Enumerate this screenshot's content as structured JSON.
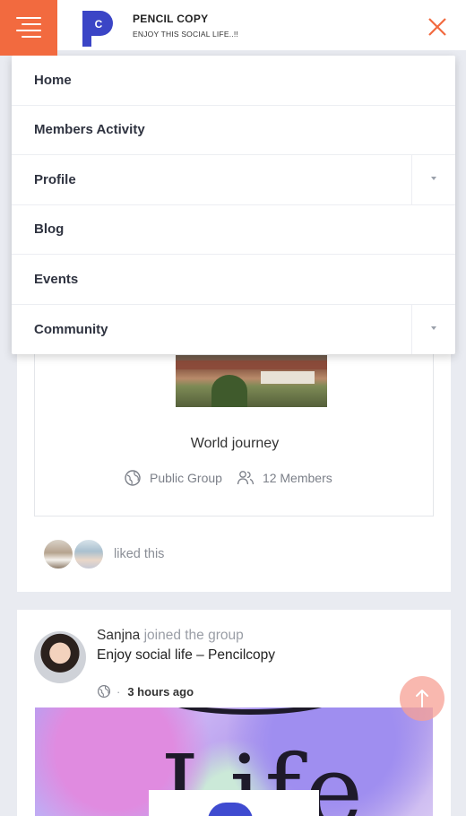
{
  "header": {
    "brand_title": "PENCIL COPY",
    "brand_subtitle": "ENJOY THIS SOCIAL LIFE..!!",
    "menu_icon": "menu-icon",
    "close_icon": "close-icon",
    "accent_color": "#f26a3f",
    "logo_color": "#3b45c6"
  },
  "menu": {
    "items": [
      {
        "label": "Home",
        "has_submenu": false
      },
      {
        "label": "Members Activity",
        "has_submenu": false
      },
      {
        "label": "Profile",
        "has_submenu": true
      },
      {
        "label": "Blog",
        "has_submenu": false
      },
      {
        "label": "Events",
        "has_submenu": false
      },
      {
        "label": "Community",
        "has_submenu": true
      }
    ]
  },
  "group_card": {
    "name": "World journey",
    "privacy": "Public Group",
    "members": "12 Members",
    "liked_text": "liked this"
  },
  "activity": {
    "user": "Sanjna",
    "action": "joined the group",
    "group": "Enjoy social life – Pencilcopy",
    "time": "3 hours ago"
  }
}
